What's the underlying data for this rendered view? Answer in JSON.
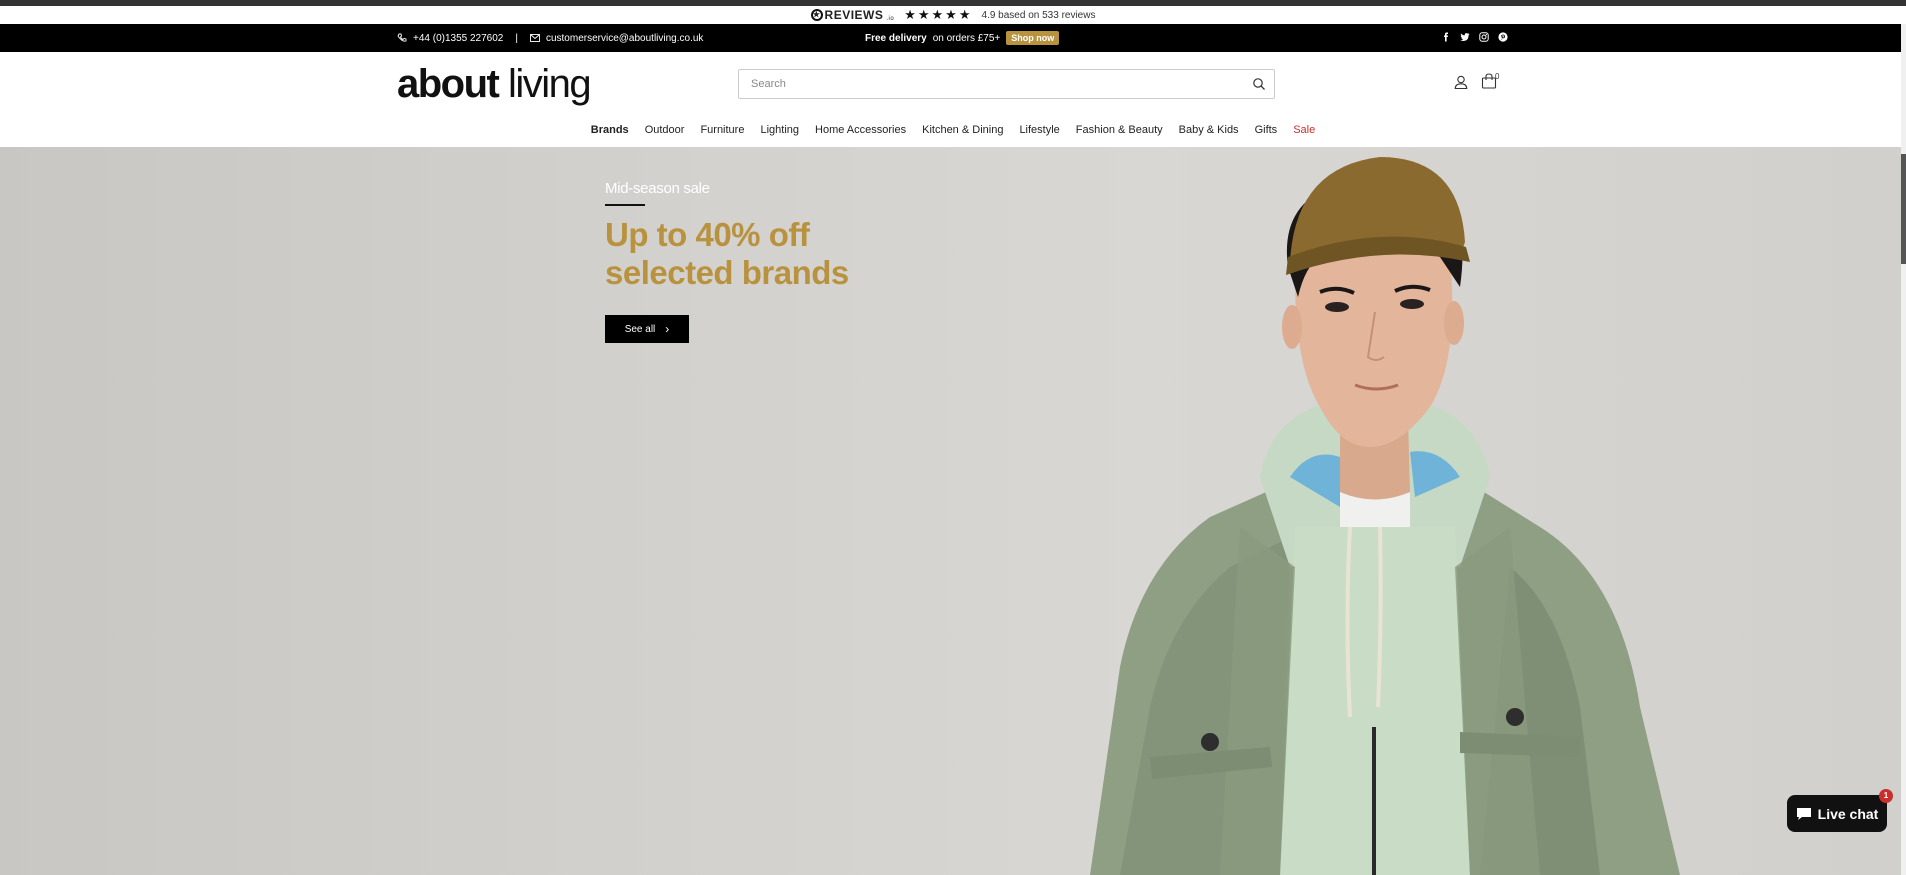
{
  "reviews_bar": {
    "logo": "REVIEWS",
    "logo_suffix": ".io",
    "stars": "★★★★★",
    "summary": "4.9 based on 533 reviews"
  },
  "announcement": {
    "phone": "+44 (0)1355 227602",
    "separator": "|",
    "email": "customerservice@aboutliving.co.uk",
    "promo_bold": "Free delivery",
    "promo_rest": "on orders £75+",
    "promo_button": "Shop now",
    "social": [
      "facebook-icon",
      "twitter-icon",
      "instagram-icon",
      "pinterest-icon"
    ]
  },
  "header": {
    "brand_bold": "about",
    "brand_light": "living",
    "search_placeholder": "Search",
    "cart_count": "0"
  },
  "nav": {
    "items": [
      {
        "label": "Brands"
      },
      {
        "label": "Outdoor"
      },
      {
        "label": "Furniture"
      },
      {
        "label": "Lighting"
      },
      {
        "label": "Home Accessories"
      },
      {
        "label": "Kitchen & Dining"
      },
      {
        "label": "Lifestyle"
      },
      {
        "label": "Fashion & Beauty"
      },
      {
        "label": "Baby & Kids"
      },
      {
        "label": "Gifts"
      },
      {
        "label": "Sale"
      }
    ]
  },
  "hero": {
    "eyebrow": "Mid-season sale",
    "headline_line1": "Up to 40% off",
    "headline_line2": "selected brands",
    "cta_label": "See all"
  },
  "livechat": {
    "label": "Live chat",
    "badge": "1"
  },
  "colors": {
    "accent_gold": "#b8923f",
    "sale_red": "#c9302c",
    "bar_black": "#000000"
  }
}
